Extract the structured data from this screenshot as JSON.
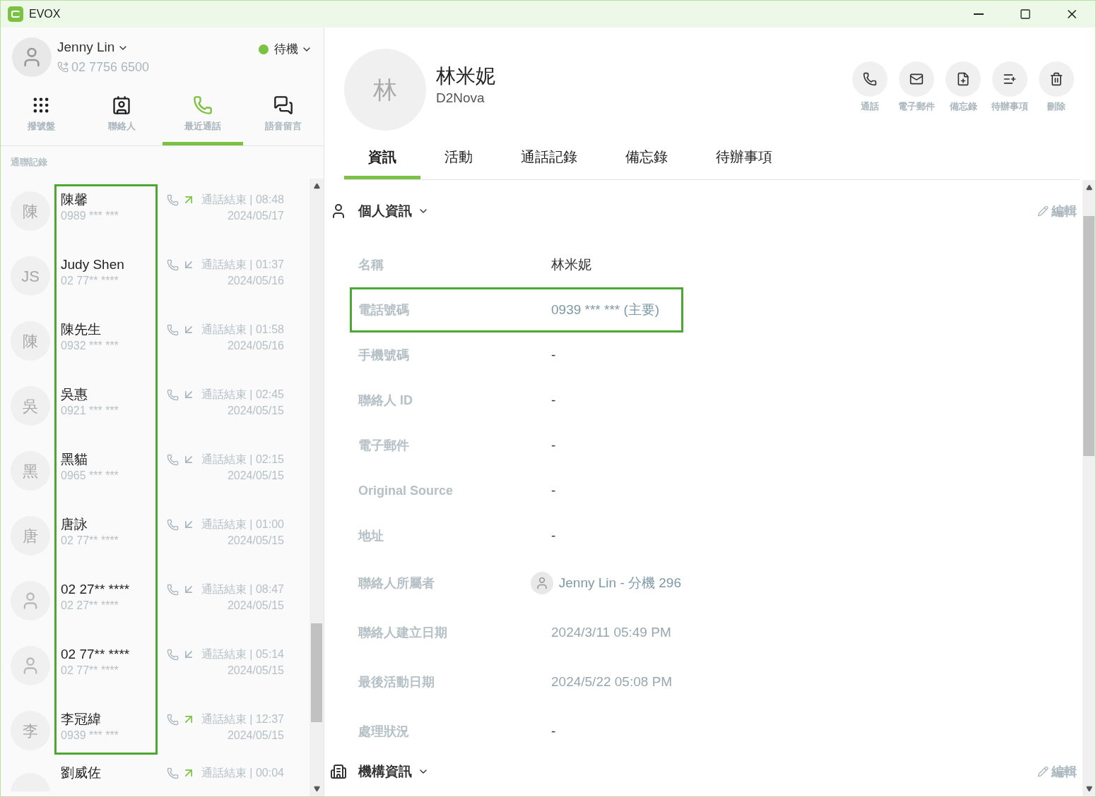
{
  "window": {
    "title": "EVOX"
  },
  "user": {
    "name": "Jenny Lin",
    "phone": "02 7756 6500",
    "status": "待機"
  },
  "nav_tabs": [
    {
      "label": "撥號盤",
      "selected": false
    },
    {
      "label": "聯絡人",
      "selected": false
    },
    {
      "label": "最近通話",
      "selected": true
    },
    {
      "label": "語音留言",
      "selected": false
    }
  ],
  "call_list": {
    "heading": "通聯記錄",
    "names_highlighted": true,
    "rows": [
      {
        "avatar": "陳",
        "kind": "initial",
        "name": "陳馨",
        "number": "0989 *** ***",
        "outgoing": true,
        "status": "通話結束 | 08:48",
        "date": "2024/05/17"
      },
      {
        "avatar": "JS",
        "kind": "initial",
        "name": "Judy Shen",
        "number": "02 77** ****",
        "outgoing": false,
        "status": "通話結束 | 01:37",
        "date": "2024/05/16"
      },
      {
        "avatar": "陳",
        "kind": "initial",
        "name": "陳先生",
        "number": "0932 *** ***",
        "outgoing": false,
        "status": "通話結束 | 01:58",
        "date": "2024/05/16"
      },
      {
        "avatar": "吳",
        "kind": "initial",
        "name": "吳惠",
        "number": "0921 *** ***",
        "outgoing": false,
        "status": "通話結束 | 02:45",
        "date": "2024/05/15"
      },
      {
        "avatar": "黑",
        "kind": "initial",
        "name": "黑貓",
        "number": "0965 *** ***",
        "outgoing": false,
        "status": "通話結束 | 02:15",
        "date": "2024/05/15"
      },
      {
        "avatar": "唐",
        "kind": "initial",
        "name": "唐詠",
        "number": "02 77** ****",
        "outgoing": false,
        "status": "通話結束 | 01:00",
        "date": "2024/05/15"
      },
      {
        "kind": "person",
        "name": "02 27** ****",
        "number": "02 27** ****",
        "outgoing": false,
        "status": "通話結束 | 08:47",
        "date": "2024/05/15"
      },
      {
        "kind": "person",
        "name": "02 77** ****",
        "number": "02 77** ****",
        "outgoing": false,
        "status": "通話結束 | 05:14",
        "date": "2024/05/15"
      },
      {
        "avatar": "李",
        "kind": "initial",
        "name": "李冠緯",
        "number": "0939 *** ***",
        "outgoing": true,
        "status": "通話結束 | 12:37",
        "date": "2024/05/15"
      },
      {
        "kind": "partial",
        "name": "劉威佐",
        "outgoing": true,
        "status": "通話結束 | 00:04"
      }
    ]
  },
  "contact": {
    "avatar": "林",
    "name": "林米妮",
    "company": "D2Nova",
    "actions": [
      {
        "label": "通話"
      },
      {
        "label": "電子郵件"
      },
      {
        "label": "備忘錄"
      },
      {
        "label": "待辦事項"
      },
      {
        "label": "刪除"
      }
    ],
    "tabs": [
      {
        "label": "資訊",
        "selected": true
      },
      {
        "label": "活動",
        "selected": false
      },
      {
        "label": "通話記錄",
        "selected": false
      },
      {
        "label": "備忘錄",
        "selected": false
      },
      {
        "label": "待辦事項",
        "selected": false
      }
    ]
  },
  "personal_section": {
    "title": "個人資訊",
    "edit": "編輯",
    "fields": [
      {
        "label": "名稱",
        "value": "林米妮",
        "kind": "text",
        "highlighted": false
      },
      {
        "label": "電話號碼",
        "value": "0939 *** *** (主要)",
        "kind": "link",
        "highlighted": true
      },
      {
        "label": "手機號碼",
        "value": "-",
        "kind": "text",
        "highlighted": false
      },
      {
        "label": "聯絡人 ID",
        "value": "-",
        "kind": "text",
        "highlighted": false
      },
      {
        "label": "電子郵件",
        "value": "-",
        "kind": "text",
        "highlighted": false
      },
      {
        "label": "Original Source",
        "value": "-",
        "kind": "text",
        "highlighted": false
      },
      {
        "label": "地址",
        "value": "-",
        "kind": "text",
        "highlighted": false
      },
      {
        "label": "聯絡人所屬者",
        "value": "Jenny Lin - 分機 296",
        "kind": "owner",
        "highlighted": false
      },
      {
        "label": "聯絡人建立日期",
        "value": "2024/3/11 05:49 PM",
        "kind": "muted",
        "highlighted": false
      },
      {
        "label": "最後活動日期",
        "value": "2024/5/22 05:08 PM",
        "kind": "muted",
        "highlighted": false
      },
      {
        "label": "處理狀況",
        "value": "-",
        "kind": "text",
        "highlighted": false
      }
    ]
  },
  "org_section": {
    "title": "機構資訊",
    "edit": "編輯"
  }
}
